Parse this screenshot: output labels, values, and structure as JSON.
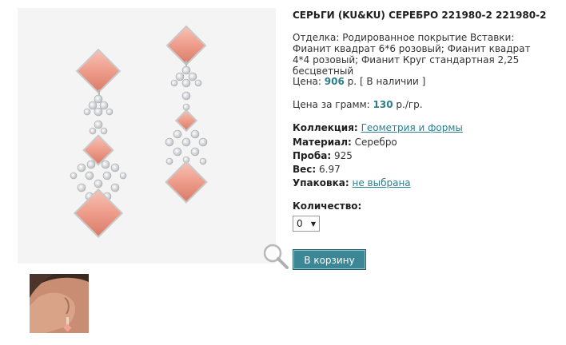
{
  "product": {
    "title": "СЕРЬГИ (KU&KU) СЕРЕБРО 221980-2 221980-2",
    "description": "Отделка: Родированное покрытие Вставки: Фианит квадрат 6*6 розовый; Фианит квадрат 4*4 розовый; Фианит Круг стандартная 2,25 бесцветный",
    "price_label": "Цена:",
    "price_value": "906",
    "price_unit": "р.",
    "availability": "[ В наличии ]",
    "price_per_gram_label": "Цена за грамм:",
    "price_per_gram_value": "130",
    "price_per_gram_unit": "р./гр.",
    "collection_label": "Коллекция:",
    "collection_value": "Геометрия и формы",
    "material_label": "Материал:",
    "material_value": "Серебро",
    "proba_label": "Проба:",
    "proba_value": "925",
    "weight_label": "Вес:",
    "weight_value": "6.97",
    "packaging_label": "Упаковка:",
    "packaging_value": "не выбрана",
    "quantity_label": "Количество:",
    "quantity_value": "0",
    "cart_button": "В корзину"
  },
  "colors": {
    "accent": "#3b8796",
    "link": "#2c7f8e",
    "price": "#2e7d8a",
    "stone_pink": "#f0a495"
  },
  "icons": {
    "zoom": "magnifier-icon",
    "select_arrow": "chevron-down-icon"
  }
}
